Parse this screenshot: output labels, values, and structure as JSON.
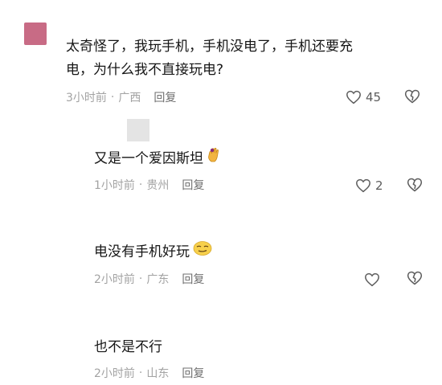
{
  "comments": [
    {
      "text_line1": "太奇怪了，我玩手机，手机没电了，手机还要充",
      "text_line2": "电，为什么我不直接玩电?",
      "time": "3小时前",
      "location": "广西",
      "reply_label": "回复",
      "likes": "45",
      "avatar_color": "#c86b85"
    },
    {
      "text": "又是一个爱因斯坦",
      "emoji": "raised-hand-emoji",
      "time": "1小时前",
      "location": "贵州",
      "reply_label": "回复",
      "likes": "2"
    },
    {
      "text": "电没有手机好玩",
      "emoji": "smirking-face-emoji",
      "time": "2小时前",
      "location": "广东",
      "reply_label": "回复"
    },
    {
      "text": "也不是不行",
      "time": "2小时前",
      "location": "山东",
      "reply_label": "回复"
    }
  ]
}
